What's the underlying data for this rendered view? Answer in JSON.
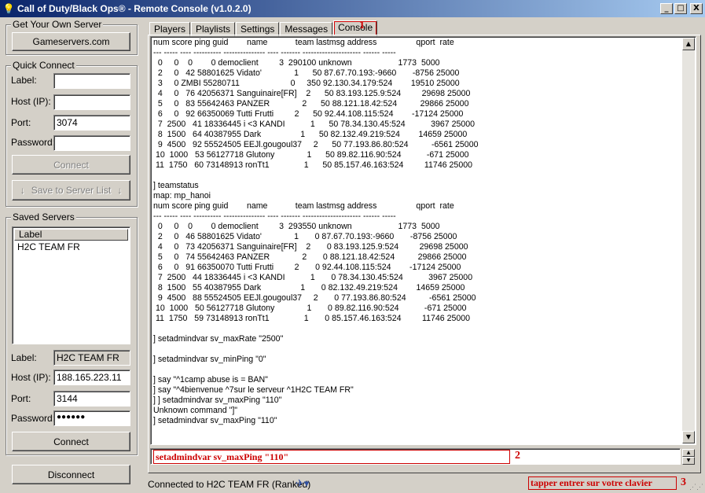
{
  "window": {
    "title": "Call of Duty/Black Ops® - Remote Console (v1.0.2.0)",
    "min_symbol": "_",
    "max_symbol": "□",
    "close_symbol": "X"
  },
  "get_servers": {
    "legend": "Get Your Own Server",
    "button": "Gameservers.com"
  },
  "quick_connect": {
    "legend": "Quick Connect",
    "label_label": "Label:",
    "label_value": "",
    "host_label": "Host (IP):",
    "host_value": "",
    "port_label": "Port:",
    "port_value": "3074",
    "password_label": "Password:",
    "password_value": "",
    "connect_button": "Connect",
    "save_button": "Save to Server List"
  },
  "saved_servers": {
    "legend": "Saved Servers",
    "column": "Label",
    "items": [
      "H2C TEAM FR"
    ],
    "label_label": "Label:",
    "label_value": "H2C TEAM FR",
    "host_label": "Host (IP):",
    "host_value": "188.165.223.11",
    "port_label": "Port:",
    "port_value": "3144",
    "password_label": "Password:",
    "password_value": "●●●●●●",
    "connect_button": "Connect"
  },
  "disconnect_button": "Disconnect",
  "tabs": [
    "Players",
    "Playlists",
    "Settings",
    "Messages",
    "Console"
  ],
  "markers": [
    "1",
    "2",
    "3"
  ],
  "console": {
    "lines": [
      "num score ping guid        name            team lastmsg address                 qport  rate",
      "--- ----- ---- ---------- --------------- ---- ------- --------------------- ------ -----",
      "  0     0    0        0 democlient         3  290100 unknown                    1773  5000",
      "  2     0   42 58801625 Vidato'              1      50 87.67.70.193:-9660       -8756 25000",
      "  3     0 ZMBI 55280711                      0     350 92.130.34.179:524        19510 25000",
      "  4     0   76 42056371 Sanguinaire[FR]    2      50 83.193.125.9:524         29698 25000",
      "  5     0   83 55642463 PANZER              2      50 88.121.18.42:524          29866 25000",
      "  6     0   92 66350069 Tutti Frutti         2      50 92.44.108.115:524        -17124 25000",
      "  7  2500   41 18336445 i <3 KANDI           1      50 78.34.130.45:524           3967 25000",
      "  8  1500   64 40387955 Dark                 1      50 82.132.49.219:524        14659 25000",
      "  9  4500   92 55524505 EEJl.gougoul37     2      50 77.193.86.80:524          -6561 25000",
      " 10  1000   53 56127718 Glutony              1      50 89.82.116.90:524           -671 25000",
      " 11  1750   60 73148913 ronTt1               1      50 85.157.46.163:524         11746 25000",
      "",
      "] teamstatus",
      "map: mp_hanoi",
      "num score ping guid        name            team lastmsg address                 qport  rate",
      "--- ----- ---- ---------- --------------- ---- ------- --------------------- ------ -----",
      "  0     0    0        0 democlient         3  293550 unknown                    1773  5000",
      "  2     0   46 58801625 Vidato'              1       0 87.67.70.193:-9660       -8756 25000",
      "  4     0   73 42056371 Sanguinaire[FR]    2       0 83.193.125.9:524         29698 25000",
      "  5     0   74 55642463 PANZER              2       0 88.121.18.42:524          29866 25000",
      "  6     0   91 66350070 Tutti Frutti         2       0 92.44.108.115:524        -17124 25000",
      "  7  2500   44 18336445 i <3 KANDI           1       0 78.34.130.45:524           3967 25000",
      "  8  1500   55 40387955 Dark                 1       0 82.132.49.219:524        14659 25000",
      "  9  4500   88 55524505 EEJl.gougoul37     2       0 77.193.86.80:524          -6561 25000",
      " 10  1000   50 56127718 Glutony              1       0 89.82.116.90:524           -671 25000",
      " 11  1750   59 73148913 ronTt1               1       0 85.157.46.163:524         11746 25000",
      "",
      "] setadmindvar sv_maxRate \"2500\"",
      "",
      "] setadmindvar sv_minPing \"0\"",
      "",
      "] say \"^1camp abuse is = BAN\"",
      "] say \"^4bienvenue ^7sur le serveur ^1H2C TEAM FR\"",
      "] ] setadmindvar sv_maxPing \"110\"",
      "Unknown command \"]\"",
      "] setadmindvar sv_maxPing \"110\""
    ]
  },
  "command_input": "setadmindvar sv_maxPing \"110\"",
  "status": {
    "text": "Connected to H2C TEAM FR (Ranked)",
    "hint": "tapper entrer sur votre clavier"
  }
}
